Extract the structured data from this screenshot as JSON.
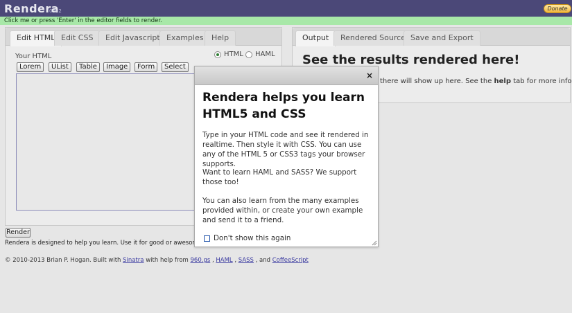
{
  "app": {
    "name": "Rendera",
    "version": "0.9.2",
    "donate_label": "Donate"
  },
  "notice": "Click me or press 'Enter' in the editor fields to render.",
  "left_tabs": [
    "Edit HTML",
    "Edit CSS",
    "Edit Javascript",
    "Examples",
    "Help"
  ],
  "right_tabs": [
    "Output",
    "Rendered Source",
    "Save and Export"
  ],
  "editor": {
    "heading": "Your HTML",
    "mode_options": [
      {
        "label": "HTML",
        "selected": true
      },
      {
        "label": "HAML",
        "selected": false
      }
    ],
    "snippets": [
      "Lorem",
      "UList",
      "Table",
      "Image",
      "Form",
      "Select"
    ],
    "value": ""
  },
  "render_label": "Render",
  "designed_text": "Rendera is designed to help you learn. Use it for good or awesome, but n",
  "output": {
    "title": "See the results rendered here!",
    "text_before": "there will show up here. See the ",
    "help_word": "help",
    "text_after": " tab for more info."
  },
  "modal": {
    "close_label": "×",
    "title": "Rendera helps you learn HTML5 and CSS",
    "paragraphs": [
      "Type in your HTML code and see it rendered in realtime. Then style it with CSS. You can use any of the HTML 5 or CSS3 tags your browser supports.",
      "Want to learn HAML and SASS? We support those too!",
      "You can also learn from the many examples provided within, or create your own example and send it to a friend."
    ],
    "checkbox_label": "Don't show this again",
    "checkbox_checked": false
  },
  "footer": {
    "prefix": "© 2010-2013 Brian P. Hogan. Built with ",
    "sinatra": "Sinatra",
    "middle": " with help from ",
    "link_960": "960.gs",
    "sep1": " , ",
    "haml": "HAML",
    "sep2": " , ",
    "sass": "SASS",
    "sep3": " , and ",
    "coffeescript": "CoffeeScript"
  },
  "colors": {
    "header_bg": "#4b4878",
    "notice_bg": "#a8e8a8",
    "page_bg": "#e6e6e6",
    "donate_bg": "#f2b73c"
  }
}
